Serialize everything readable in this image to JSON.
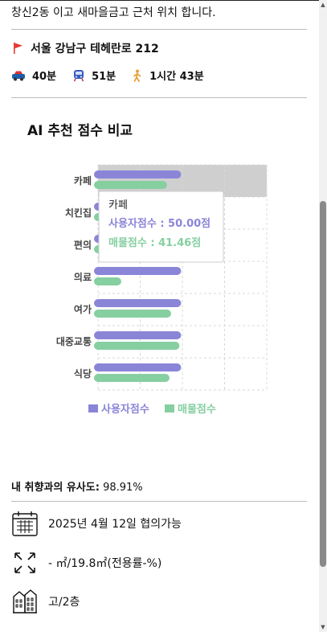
{
  "listing": {
    "description": "창신2동 이고 새마을금고 근처 위치 합니다.",
    "address": "서울 강남구 테헤란로 212",
    "commute": [
      {
        "icon": "car-icon",
        "label": "40분"
      },
      {
        "icon": "subway-icon",
        "label": "51분"
      },
      {
        "icon": "walk-icon",
        "label": "1시간 43분"
      }
    ]
  },
  "chart_section": {
    "title": "AI 추천 점수 비교"
  },
  "chart_data": {
    "type": "bar",
    "orientation": "horizontal",
    "categories": [
      "카페",
      "치킨집",
      "편의",
      "의료",
      "여가",
      "대중교통",
      "식당"
    ],
    "series": [
      {
        "name": "사용자점수",
        "color": "#8b85d8",
        "values": [
          50,
          50,
          50,
          50,
          50,
          50,
          50
        ]
      },
      {
        "name": "매물점수",
        "color": "#86cfa0",
        "values": [
          41.46,
          24,
          30,
          14,
          44,
          49,
          43
        ]
      }
    ],
    "xlim": [
      0,
      100
    ],
    "grid": true,
    "legend_position": "bottom",
    "highlight_category": "카페",
    "tooltip": {
      "category": "카페",
      "lines": [
        {
          "text": "사용자점수 : 50.00점",
          "color": "#8b85d8"
        },
        {
          "text": "매물점수 : 41.46점",
          "color": "#86cfa0"
        }
      ]
    }
  },
  "similarity": {
    "label": "내 취향과의 유사도:",
    "value": "98.91%"
  },
  "details": [
    {
      "icon": "calendar-icon",
      "text": "2025년 4월 12일 협의가능"
    },
    {
      "icon": "area-expand-icon",
      "text": "- ㎡/19.8㎡(전용률-%)"
    },
    {
      "icon": "building-icon",
      "text": "고/2층"
    }
  ],
  "colors": {
    "user": "#8b85d8",
    "listing": "#86cfa0",
    "flag": "#e53935"
  }
}
